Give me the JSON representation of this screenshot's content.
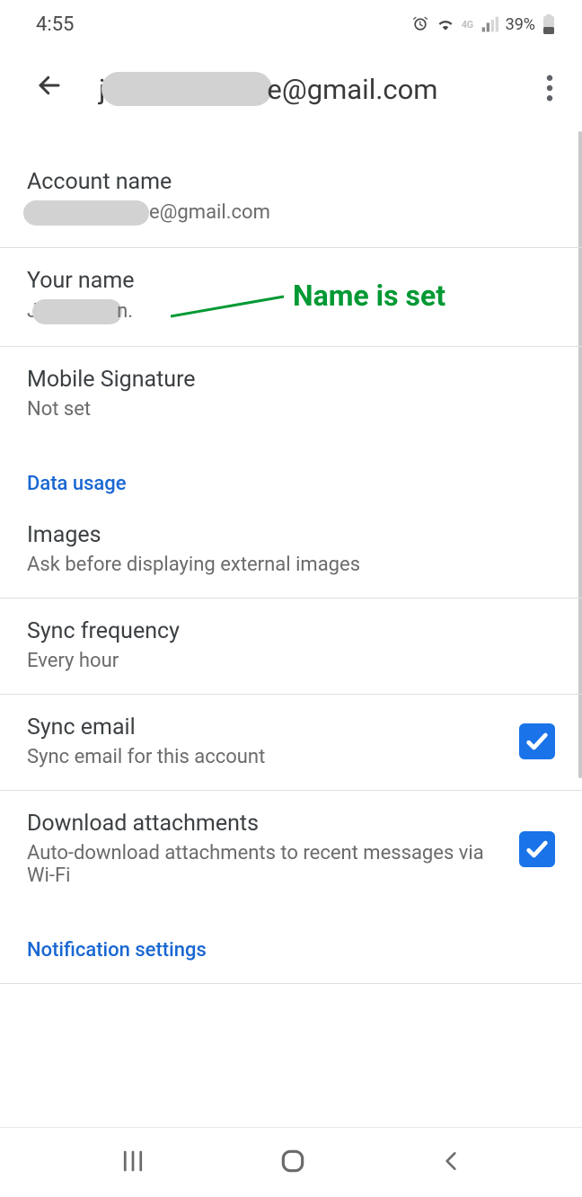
{
  "status": {
    "time": "4:55",
    "battery_text": "39%",
    "network_label": "4G"
  },
  "header": {
    "title_prefix": "j",
    "title_suffix": "e@gmail.com"
  },
  "items": {
    "account_name": {
      "title": "Account name",
      "value_suffix": "e@gmail.com"
    },
    "your_name": {
      "title": "Your name",
      "value_prefix": "J",
      "value_suffix": "n."
    },
    "mobile_signature": {
      "title": "Mobile Signature",
      "value": "Not set"
    },
    "images": {
      "title": "Images",
      "value": "Ask before displaying external images"
    },
    "sync_frequency": {
      "title": "Sync frequency",
      "value": "Every hour"
    },
    "sync_email": {
      "title": "Sync email",
      "value": "Sync email for this account"
    },
    "download_attachments": {
      "title": "Download attachments",
      "value": "Auto-download attachments to recent messages via Wi-Fi"
    }
  },
  "sections": {
    "data_usage": "Data usage",
    "notification_settings": "Notification settings"
  },
  "annotation": {
    "text": "Name is set"
  }
}
